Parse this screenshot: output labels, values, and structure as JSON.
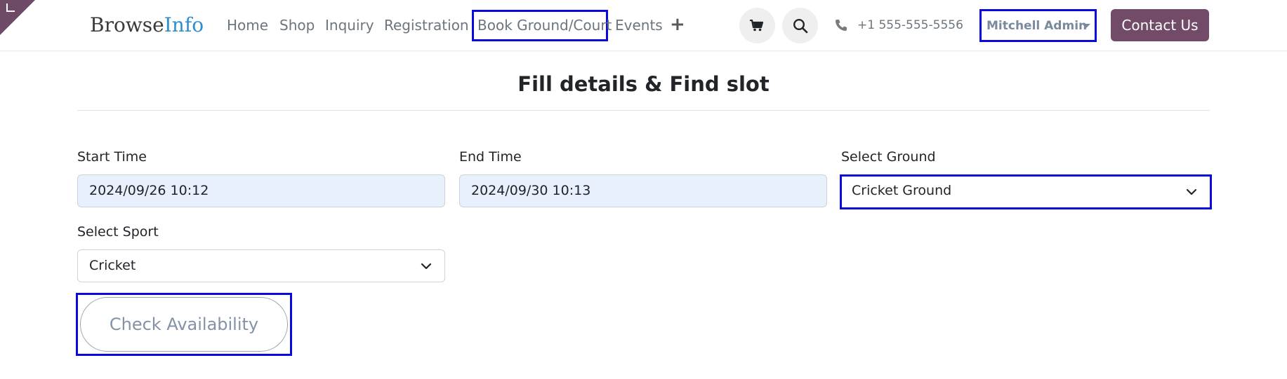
{
  "brand": {
    "name_part1": "Browse",
    "name_part2": "Info",
    "accent_color": "#2c8ecf",
    "primary_color": "#714b67",
    "highlight_color": "#0a0adf"
  },
  "nav": {
    "items": [
      {
        "label": "Home"
      },
      {
        "label": "Shop"
      },
      {
        "label": "Inquiry"
      },
      {
        "label": "Registration"
      },
      {
        "label": "Book Ground/Court"
      },
      {
        "label": "Events"
      }
    ],
    "active_item": "Book Ground/Court",
    "add_icon": "plus-icon"
  },
  "header": {
    "cart_icon": "cart-icon",
    "search_icon": "search-icon",
    "phone_icon": "phone-icon",
    "phone": "+1 555-555-5556",
    "user_name": "Mitchell Admin",
    "contact_label": "Contact Us"
  },
  "form": {
    "title": "Fill details & Find slot",
    "start_time": {
      "label": "Start Time",
      "value": "2024/09/26 10:12"
    },
    "end_time": {
      "label": "End Time",
      "value": "2024/09/30 10:13"
    },
    "ground": {
      "label": "Select Ground",
      "value": "Cricket Ground"
    },
    "sport": {
      "label": "Select Sport",
      "value": "Cricket"
    },
    "check_label": "Check Availability"
  }
}
